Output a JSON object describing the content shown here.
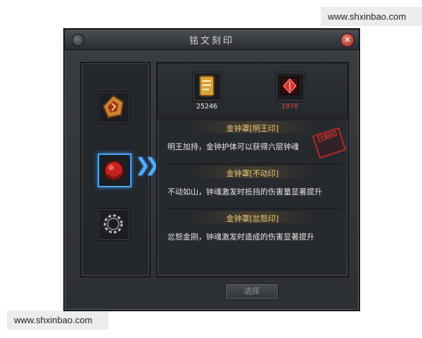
{
  "watermark": {
    "top": "www.shxinbao.com",
    "bottom": "www.shxinbao.com"
  },
  "window": {
    "title": "铭文刻印",
    "close": "×"
  },
  "top_items": [
    {
      "icon": "gold-scroll-icon",
      "count": "25246",
      "color": "#e6e6e6"
    },
    {
      "icon": "red-gem-icon",
      "count": "1970",
      "color": "#d64a42"
    }
  ],
  "runes": [
    {
      "title": "金钟罩[明王印]",
      "description": "明王加持，金钟护体可以获得六层钟魂"
    },
    {
      "title": "金钟罩[不动印]",
      "description": "不动如山，钟魂激发时抵挡的伤害量显著提升"
    },
    {
      "title": "金钟罩[忿怒印]",
      "description": "忿怒金刚，钟魂激发时造成的伤害显著提升"
    }
  ],
  "stamp": "已刻印",
  "left_slots": [
    {
      "icon": "gold-rune-icon"
    },
    {
      "icon": "red-bell-icon",
      "active": true
    },
    {
      "icon": "chain-icon"
    }
  ],
  "select_button": "选择",
  "colors": {
    "accent_blue": "#4aa6ff",
    "title_gold": "#e9c77a",
    "red": "#d64a42"
  }
}
